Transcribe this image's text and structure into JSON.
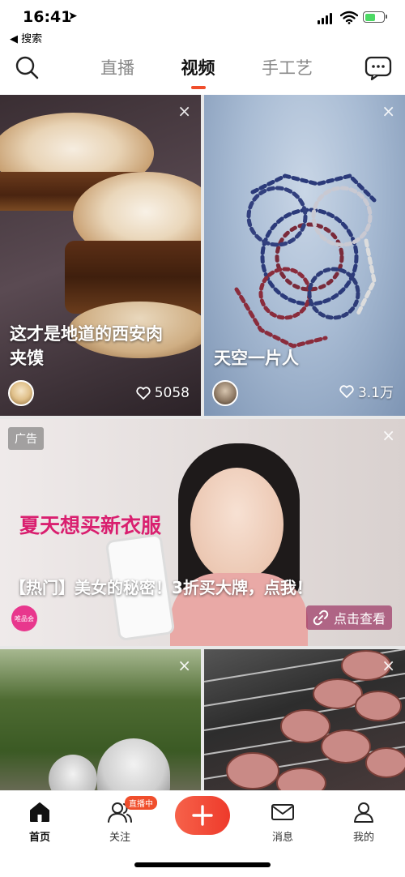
{
  "status_bar": {
    "time": "16:41",
    "location_glyph": "➤",
    "back_label": "◀ 搜索"
  },
  "top_nav": {
    "tabs": [
      {
        "label": "直播",
        "active": false
      },
      {
        "label": "视频",
        "active": true
      },
      {
        "label": "手工艺",
        "active": false
      }
    ],
    "icons": {
      "left": "search-icon",
      "right": "message-bubble-icon"
    }
  },
  "feed": {
    "cards": [
      {
        "title_line1": "这才是地道的西安肉",
        "title_line2": "夹馍",
        "likes": "5058",
        "close": "×"
      },
      {
        "title": "天空一片人",
        "likes": "3.1万",
        "close": "×"
      }
    ],
    "ad": {
      "badge": "广告",
      "headline": "夏天想买新衣服",
      "title": "【热门】美女的秘密！3折买大牌，点我！",
      "cta": "点击查看",
      "logo_text": "唯品会",
      "close": "×",
      "accent": "#d91f6f"
    },
    "bottom_cards": [
      {
        "close": "×"
      },
      {
        "close": "×"
      }
    ]
  },
  "tabbar": {
    "items": [
      {
        "label": "首页",
        "active": true,
        "icon": "home-icon"
      },
      {
        "label": "关注",
        "active": false,
        "icon": "follow-people-icon",
        "badge": "直播中"
      },
      {
        "label": "",
        "icon": "plus-icon"
      },
      {
        "label": "消息",
        "active": false,
        "icon": "envelope-icon"
      },
      {
        "label": "我的",
        "active": false,
        "icon": "person-icon"
      }
    ],
    "accent": "#f04e2c"
  }
}
